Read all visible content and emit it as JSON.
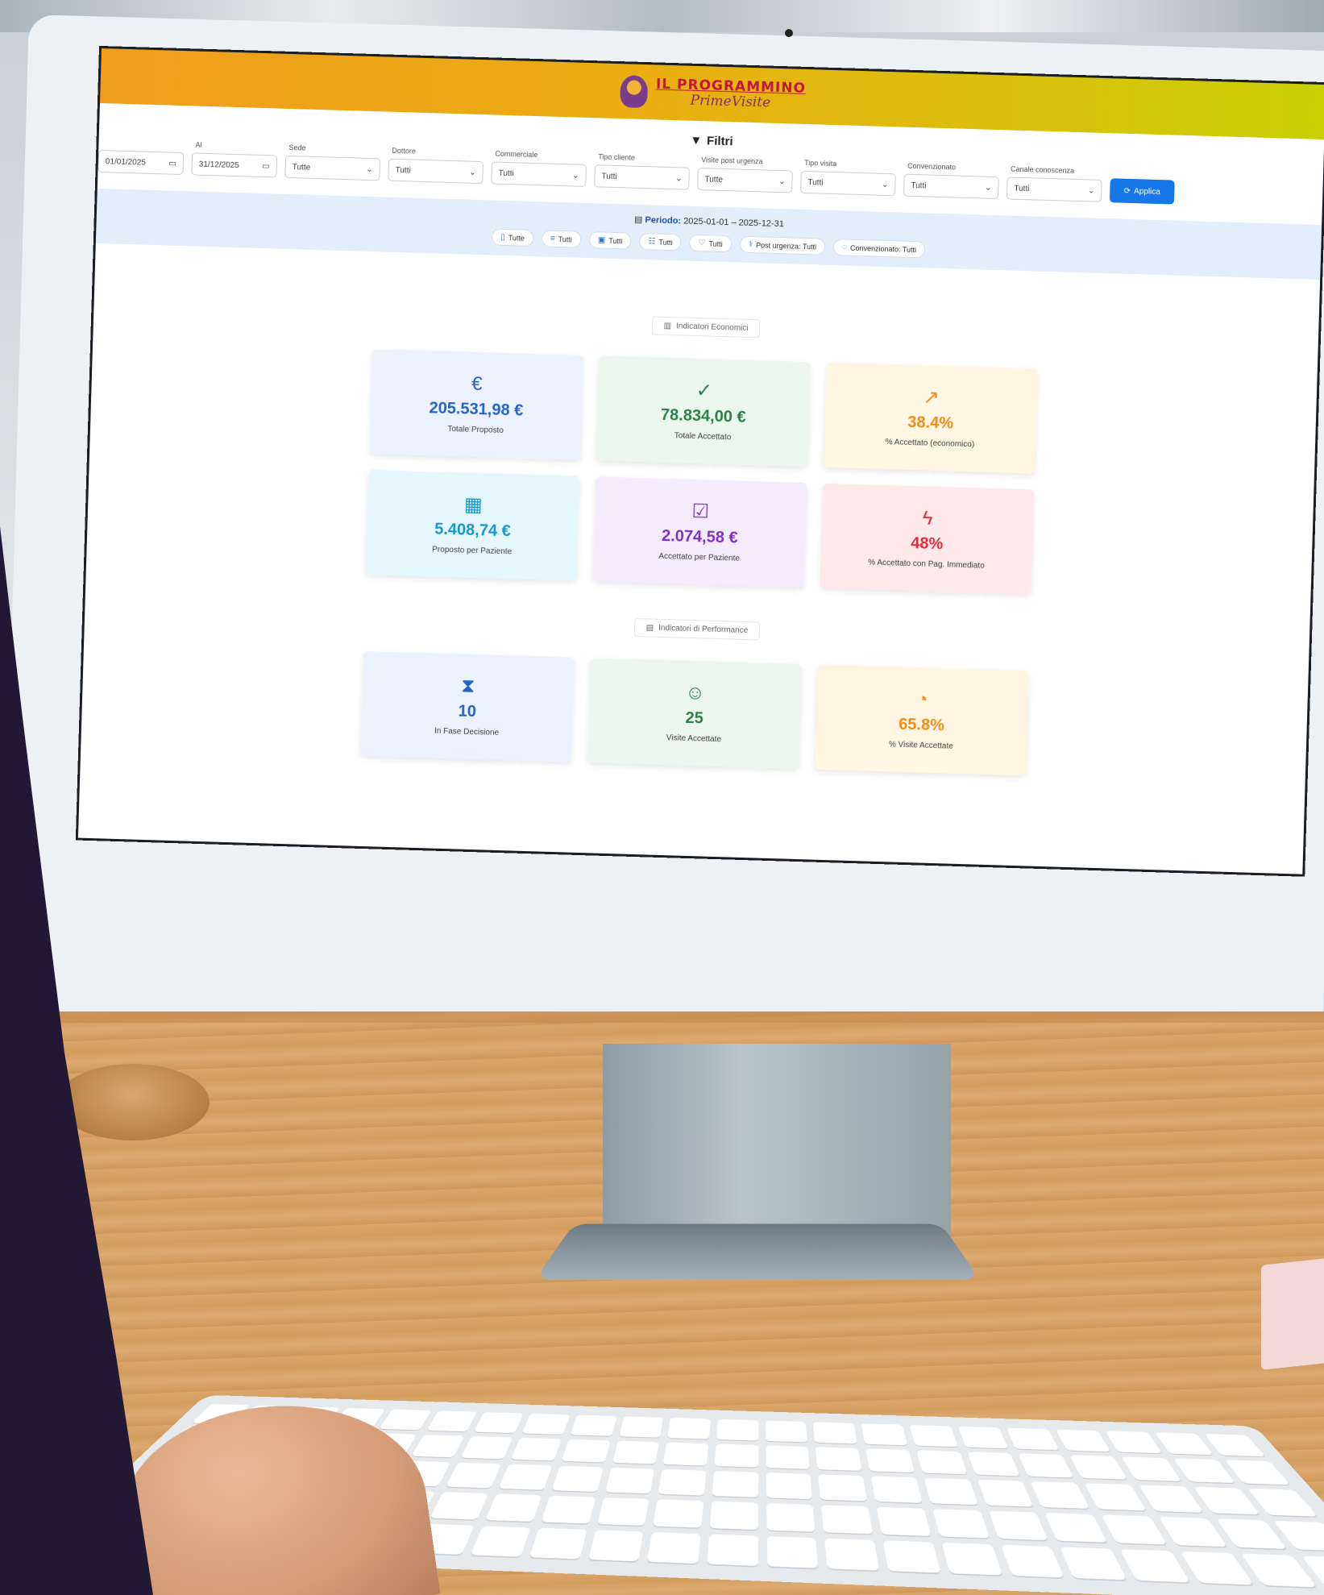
{
  "app": {
    "logo_title": "IL PROGRAMMINO",
    "logo_subtitle": "PrimeVisite"
  },
  "filters": {
    "title": "Filtri",
    "fields": [
      {
        "label": "",
        "value": "01/01/2025",
        "kind": "date"
      },
      {
        "label": "Al",
        "value": "31/12/2025",
        "kind": "date"
      },
      {
        "label": "Sede",
        "value": "Tutte",
        "kind": "select"
      },
      {
        "label": "Dottore",
        "value": "Tutti",
        "kind": "select"
      },
      {
        "label": "Commerciale",
        "value": "Tutti",
        "kind": "select"
      },
      {
        "label": "Tipo cliente",
        "value": "Tutti",
        "kind": "select"
      },
      {
        "label": "Visite post urgenza",
        "value": "Tutte",
        "kind": "select"
      },
      {
        "label": "Tipo visita",
        "value": "Tutti",
        "kind": "select"
      },
      {
        "label": "Convenzionato",
        "value": "Tutti",
        "kind": "select"
      },
      {
        "label": "Canale conoscenza",
        "value": "Tutti",
        "kind": "select"
      }
    ],
    "apply_label": "Applica"
  },
  "period": {
    "label": "Periodo:",
    "range": "2025-01-01 – 2025-12-31",
    "chips": [
      {
        "icon": "building-icon",
        "glyph": "▯",
        "text": "Tutte"
      },
      {
        "icon": "doctor-icon",
        "glyph": "≡",
        "text": "Tutti"
      },
      {
        "icon": "briefcase-icon",
        "glyph": "▣",
        "text": "Tutti"
      },
      {
        "icon": "users-icon",
        "glyph": "☷",
        "text": "Tutti"
      },
      {
        "icon": "tag-icon",
        "glyph": "♡",
        "text": "Tutti"
      },
      {
        "icon": "ambulance-icon",
        "glyph": "⚕",
        "text": "Post urgenza: Tutti"
      },
      {
        "icon": "shield-icon",
        "glyph": "◌",
        "text": "Convenzionato: Tutti"
      }
    ]
  },
  "sections": {
    "economic": "Indicatori Economici",
    "performance": "Indicatori di Performance"
  },
  "economic_cards": [
    {
      "name": "totale-proposto",
      "icon": "euro-icon",
      "glyph": "€",
      "value": "205.531,98 €",
      "caption": "Totale Proposto",
      "theme": "c-blue"
    },
    {
      "name": "totale-accettato",
      "icon": "check-circle-icon",
      "glyph": "✓",
      "value": "78.834,00 €",
      "caption": "Totale Accettato",
      "theme": "c-green"
    },
    {
      "name": "percent-accettato-economico",
      "icon": "trend-up-icon",
      "glyph": "↗",
      "value": "38.4%",
      "caption": "% Accettato (economico)",
      "theme": "c-orange"
    },
    {
      "name": "proposto-per-paziente",
      "icon": "calculator-icon",
      "glyph": "▦",
      "value": "5.408,74 €",
      "caption": "Proposto per Paziente",
      "theme": "c-cyan"
    },
    {
      "name": "accettato-per-paziente",
      "icon": "clipboard-check-icon",
      "glyph": "☑",
      "value": "2.074,58 €",
      "caption": "Accettato per Paziente",
      "theme": "c-purple"
    },
    {
      "name": "percent-pagamento-immediato",
      "icon": "lightning-icon",
      "glyph": "ϟ",
      "value": "48%",
      "caption": "% Accettato con Pag. Immediato",
      "theme": "c-red"
    }
  ],
  "performance_cards": [
    {
      "name": "in-fase-decisione",
      "icon": "hourglass-icon",
      "glyph": "⧗",
      "value": "10",
      "caption": "In Fase Decisione",
      "theme": "c-blue"
    },
    {
      "name": "visite-accettate",
      "icon": "user-check-icon",
      "glyph": "☺",
      "value": "25",
      "caption": "Visite Accettate",
      "theme": "c-green"
    },
    {
      "name": "percent-visite-accettate",
      "icon": "pie-chart-icon",
      "glyph": "◔",
      "value": "65.8%",
      "caption": "% Visite Accettate",
      "theme": "c-orange"
    }
  ]
}
